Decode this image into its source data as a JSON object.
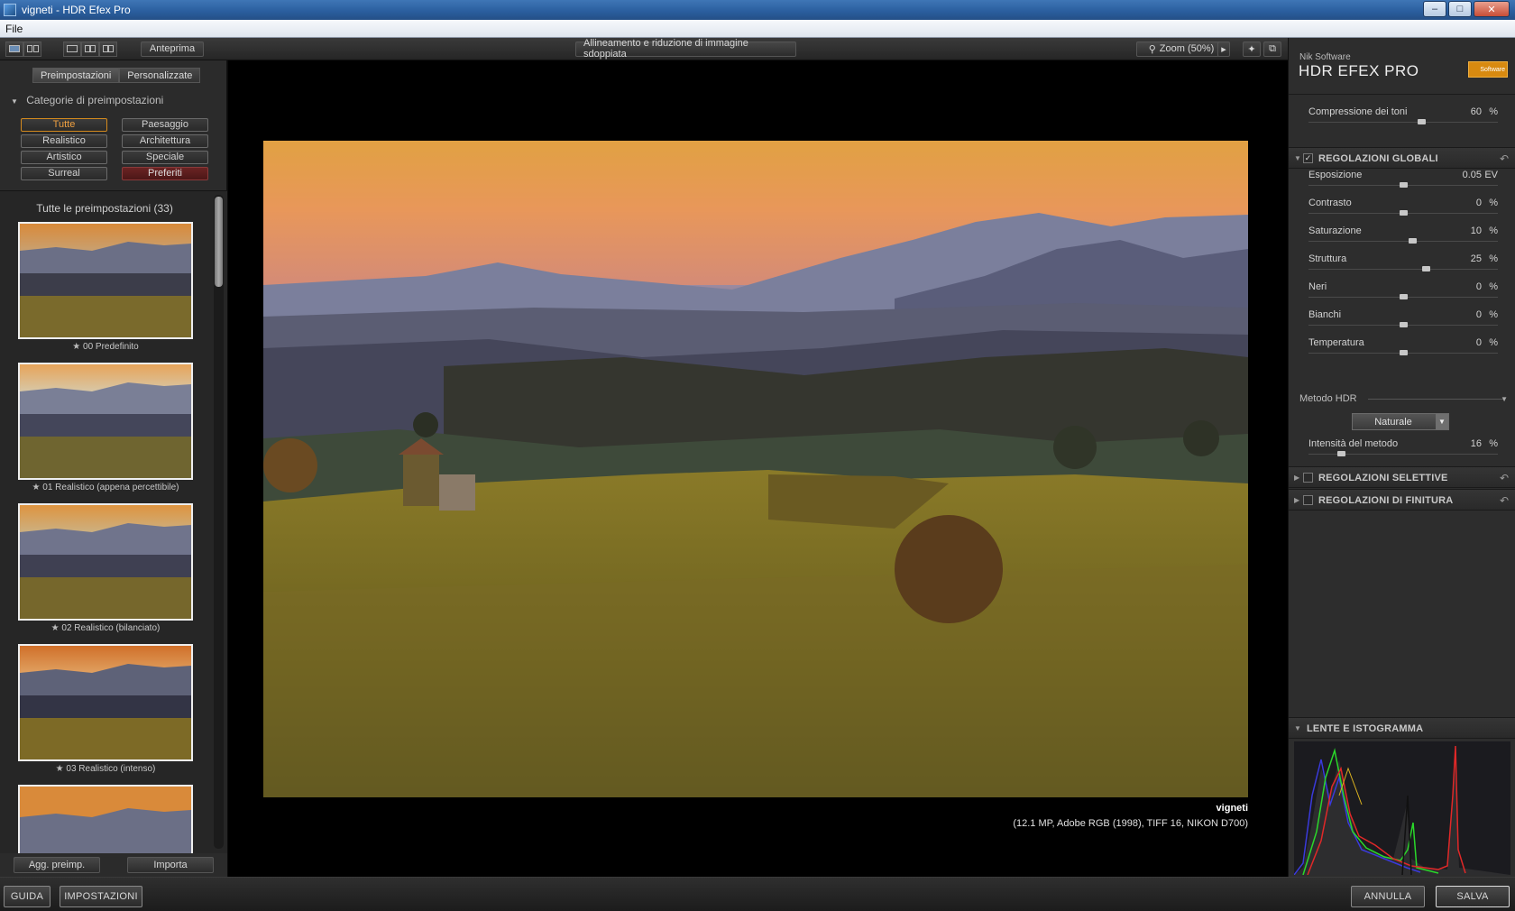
{
  "window": {
    "title": "vigneti - HDR Efex Pro"
  },
  "menu": {
    "file": "File"
  },
  "toolbar": {
    "preview": "Anteprima",
    "align": "Allineamento e riduzione di immagine sdoppiata",
    "zoom": "Zoom (50%)"
  },
  "left": {
    "tabs": [
      "Preimpostazioni",
      "Personalizzate"
    ],
    "categories_header": "Categorie di preimpostazioni",
    "categories": [
      "Tutte",
      "Paesaggio",
      "Realistico",
      "Architettura",
      "Artistico",
      "Speciale",
      "Surreal",
      "Preferiti"
    ],
    "presets_title": "Tutte le preimpostazioni (33)",
    "presets": [
      "00 Predefinito",
      "01 Realistico (appena percettibile)",
      "02 Realistico (bilanciato)",
      "03 Realistico (intenso)"
    ],
    "add_button": "Agg. preimp.",
    "import_button": "Importa"
  },
  "image": {
    "name": "vigneti",
    "info": "(12.1 MP, Adobe RGB (1998), TIFF 16, NIKON D700)"
  },
  "right": {
    "brand_sub": "Nik Software",
    "brand": "HDR EFEX PRO",
    "logo_text": "Software",
    "tone_compression": {
      "label": "Compressione dei toni",
      "value": "60",
      "unit": "%",
      "level": 0.6
    },
    "global_title": "REGOLAZIONI GLOBALI",
    "sliders": [
      {
        "label": "Esposizione",
        "value": "0.05",
        "unit": "EV",
        "level": 0.5
      },
      {
        "label": "Contrasto",
        "value": "0",
        "unit": "%",
        "level": 0.5
      },
      {
        "label": "Saturazione",
        "value": "10",
        "unit": "%",
        "level": 0.55
      },
      {
        "label": "Struttura",
        "value": "25",
        "unit": "%",
        "level": 0.625
      },
      {
        "label": "Neri",
        "value": "0",
        "unit": "%",
        "level": 0.5
      },
      {
        "label": "Bianchi",
        "value": "0",
        "unit": "%",
        "level": 0.5
      },
      {
        "label": "Temperatura",
        "value": "0",
        "unit": "%",
        "level": 0.5
      }
    ],
    "hdr_method_label": "Metodo HDR",
    "hdr_method_value": "Naturale",
    "method_intensity": {
      "label": "Intensità del metodo",
      "value": "16",
      "unit": "%",
      "level": 0.16
    },
    "selective_title": "REGOLAZIONI SELETTIVE",
    "finishing_title": "REGOLAZIONI DI FINITURA",
    "histogram_title": "LENTE E ISTOGRAMMA"
  },
  "bottom": {
    "guide": "GUIDA",
    "settings": "IMPOSTAZIONI",
    "cancel": "ANNULLA",
    "save": "SALVA"
  }
}
